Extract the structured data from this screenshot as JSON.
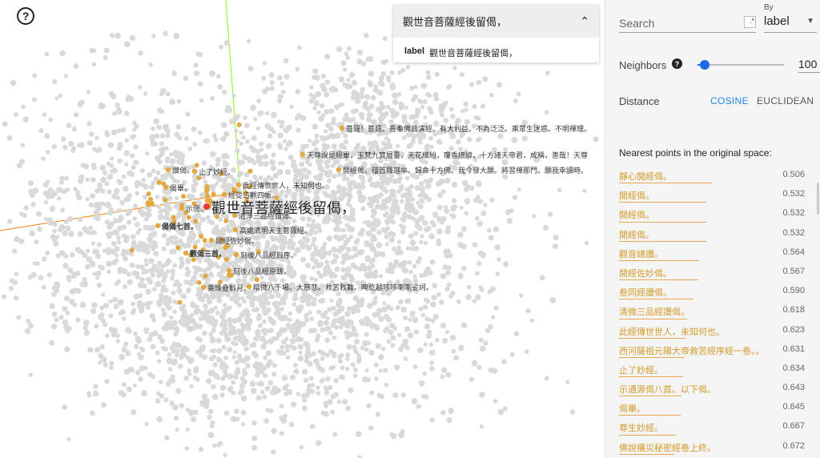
{
  "canvas": {
    "help_glyph": "?",
    "selected_label": "觀世音菩薩經後留偈，",
    "labels": [
      {
        "text": "菩薩！菩薩。吾奉佛旨演經。有大利益。不為泛泛。乘眾生迷惑。不明禪理。",
        "bold": false
      },
      {
        "text": "天尊說是經畢，玉梵九寶層臺，天花繽紛，瓊香繚繞，十方諸天帝君，咸稱，善哉！天尊",
        "bold": false
      },
      {
        "text": "開經偈。稽首釋迦牟。歸命十方佛。我今發大願。將習禪那門。願我幸讀時。",
        "bold": false
      },
      {
        "text": "讚偈。",
        "bold": false
      },
      {
        "text": "止了妙經。",
        "bold": false
      },
      {
        "text": "此經傳世世人，未知何也。",
        "bold": false
      },
      {
        "text": "偈畢。",
        "bold": false
      },
      {
        "text": "經從這觀四帳。",
        "bold": false
      },
      {
        "text": "示偈。",
        "bold": false
      },
      {
        "text": "清淨三品經讚偈。",
        "bold": false
      },
      {
        "text": "偈偈七首。",
        "bold": true
      },
      {
        "text": "高處清明天主菩薩經。",
        "bold": false
      },
      {
        "text": "開經佐妙偈。",
        "bold": false
      },
      {
        "text": "觀偈三首，",
        "bold": true
      },
      {
        "text": "刻後八品經目序。",
        "bold": false
      },
      {
        "text": "刻後八品經原跋。",
        "bold": false
      },
      {
        "text": "乘珠叠斛月。",
        "bold": false
      },
      {
        "text": "暗微八千場。大慈悲。救苦救難。唵訖越哆哆喇喇娑訶。",
        "bold": false
      }
    ]
  },
  "selection_card": {
    "title": "觀世音菩薩經後留偈，",
    "chevron": "⌃",
    "key": "label",
    "value": "觀世音菩薩經後留偈，"
  },
  "panel": {
    "search": {
      "placeholder": "Search",
      "regex_glyph": ".*"
    },
    "by": {
      "label": "By",
      "value": "label",
      "arrow": "▼"
    },
    "neighbors": {
      "label": "Neighbors",
      "help": "?",
      "value": "100",
      "spin": "▲▼",
      "fraction": 0.08
    },
    "distance": {
      "label": "Distance",
      "cosine": "COSINE",
      "euclidean": "EUCLIDEAN",
      "selected": "COSINE"
    },
    "nearest_title": "Nearest points in the original space:",
    "nearest": [
      {
        "label": "靜心開經偈。",
        "value": "0.506"
      },
      {
        "label": "開經偈。",
        "value": "0.532"
      },
      {
        "label": "開經偈。",
        "value": "0.532"
      },
      {
        "label": "開經偈。",
        "value": "0.532"
      },
      {
        "label": "觀音總讚。",
        "value": "0.564"
      },
      {
        "label": "開經佐妙偈。",
        "value": "0.567"
      },
      {
        "label": "叁同經讚偈。",
        "value": "0.590"
      },
      {
        "label": "清微三品經讚偈。",
        "value": "0.618"
      },
      {
        "label": "此經傳世世人，未知何也。",
        "value": "0.623"
      },
      {
        "label": "西河薩祖元陽大帝救苦經序經一卷。。",
        "value": "0.631"
      },
      {
        "label": "止了妙經。",
        "value": "0.634"
      },
      {
        "label": "示通源偈八首。以下偈。",
        "value": "0.643"
      },
      {
        "label": "偈畢。",
        "value": "0.645"
      },
      {
        "label": "尊生妙經。",
        "value": "0.667"
      },
      {
        "label": "佛說禳災秘密經卷上終。",
        "value": "0.672"
      }
    ]
  },
  "colors": {
    "point": "#d9d9d9",
    "neighbor": "#e3a941",
    "selected": "#e53935",
    "accent": "#1e88e5",
    "axis_x": "#f57c00",
    "axis_y": "#7cfc00"
  }
}
